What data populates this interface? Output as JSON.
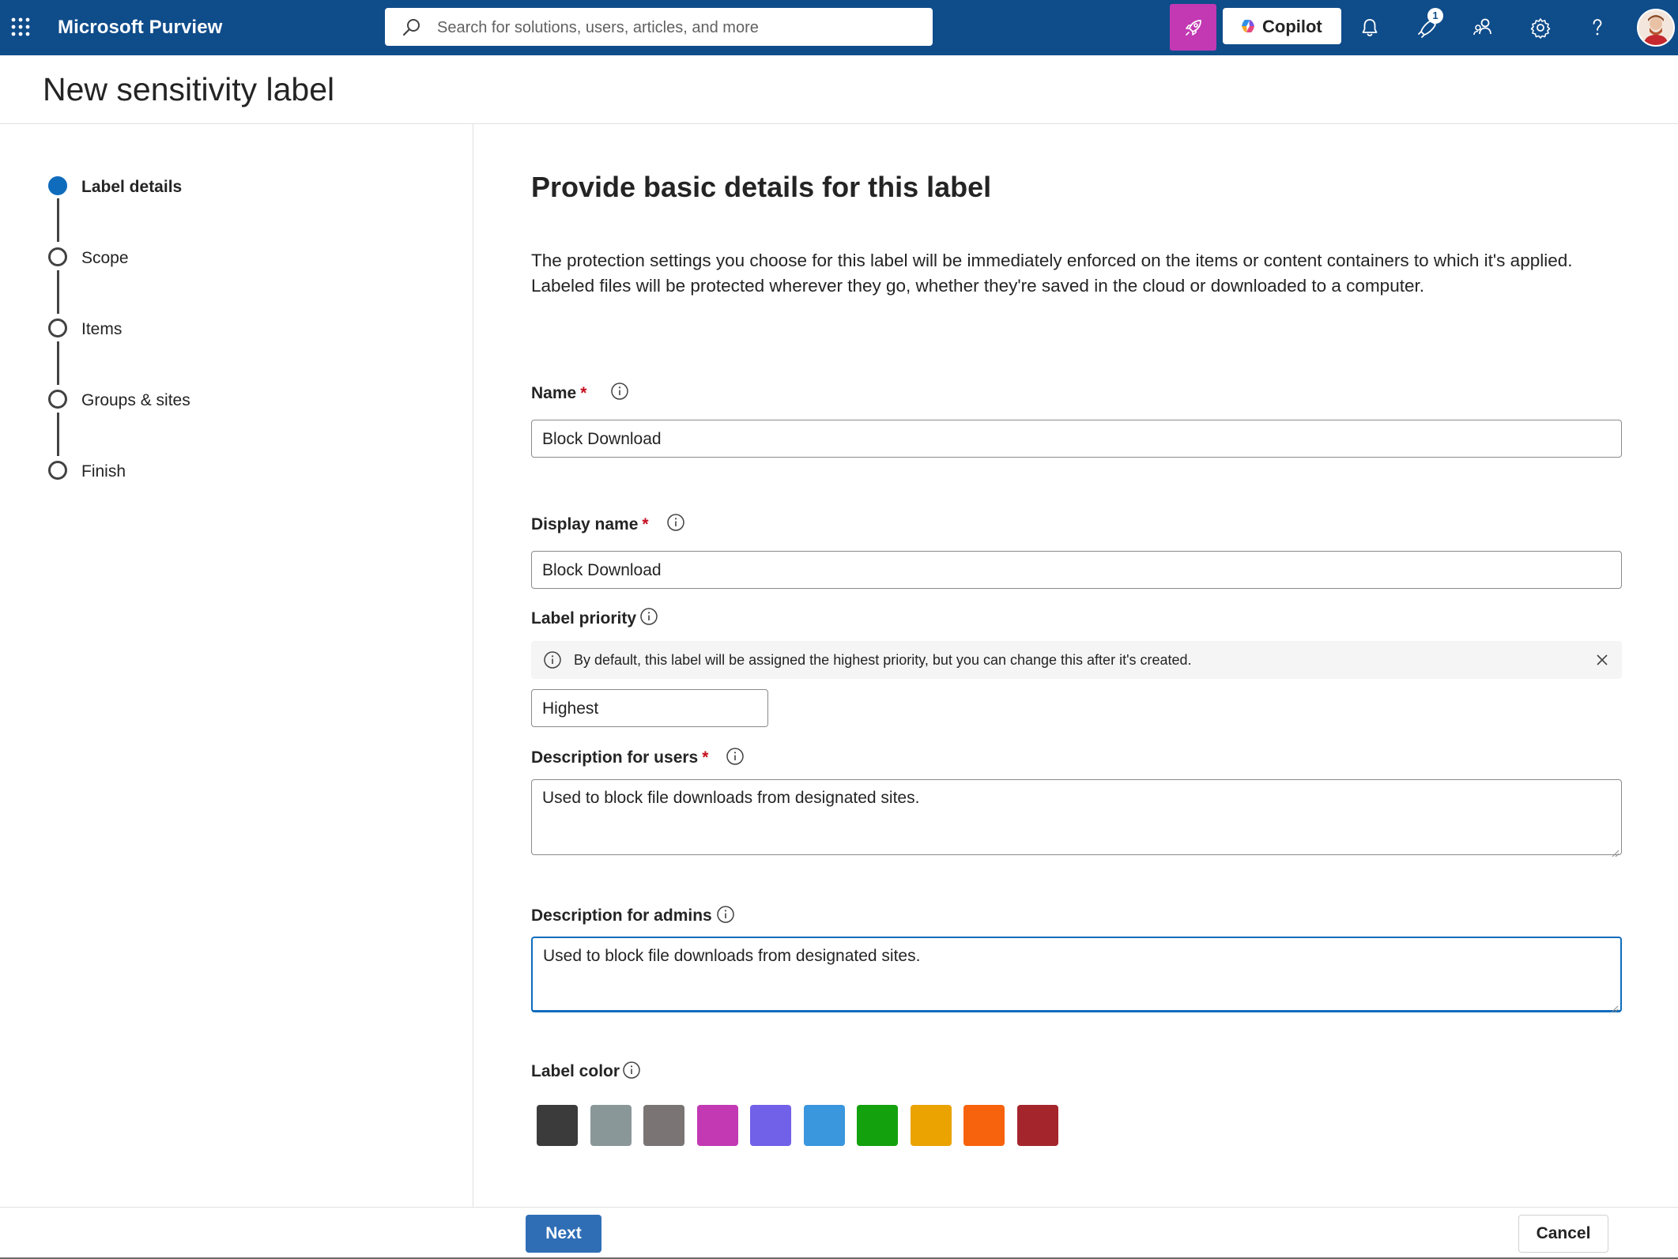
{
  "topbar": {
    "app_name": "Microsoft Purview",
    "search_placeholder": "Search for solutions, users, articles, and more",
    "copilot_label": "Copilot",
    "notification_badge": "1",
    "icons": [
      "waffle-icon",
      "search-icon",
      "rocket-icon",
      "copilot-icon",
      "bell-icon",
      "whats-new-icon",
      "people-connect-icon",
      "gear-icon",
      "help-icon",
      "avatar"
    ]
  },
  "page": {
    "title": "New sensitivity label"
  },
  "steps": [
    {
      "label": "Label details",
      "active": true
    },
    {
      "label": "Scope",
      "active": false
    },
    {
      "label": "Items",
      "active": false
    },
    {
      "label": "Groups & sites",
      "active": false
    },
    {
      "label": "Finish",
      "active": false
    }
  ],
  "form": {
    "heading": "Provide basic details for this label",
    "intro": "The protection settings you choose for this label will be immediately enforced on the items or content containers to which it's applied. Labeled files will be protected wherever they go, whether they're saved in the cloud or downloaded to a computer.",
    "name": {
      "label": "Name",
      "required_mark": "*",
      "value": "Block Download"
    },
    "display_name": {
      "label": "Display name",
      "required_mark": "*",
      "value": "Block Download"
    },
    "priority": {
      "label": "Label priority",
      "info_text": "By default, this label will be assigned the highest priority, but you can change this after it's created.",
      "value": "Highest"
    },
    "desc_users": {
      "label": "Description for users",
      "required_mark": "*",
      "value": "Used to block file downloads from designated sites."
    },
    "desc_admins": {
      "label": "Description for admins",
      "value": "Used to block file downloads from designated sites."
    },
    "label_color": {
      "label": "Label color",
      "colors": [
        "#3b3b3b",
        "#8a9799",
        "#7a7574",
        "#c239b3",
        "#7160e8",
        "#3a96dd",
        "#13a10e",
        "#eaa300",
        "#f7630c",
        "#a4262c"
      ]
    }
  },
  "footer": {
    "next_label": "Next",
    "cancel_label": "Cancel"
  },
  "colors": {
    "topbar_bg": "#0f4c8a",
    "accent": "#0f6cbd",
    "next_button": "#2f6eb5",
    "required": "#c50f1f",
    "rocket_button": "#c239b3"
  }
}
